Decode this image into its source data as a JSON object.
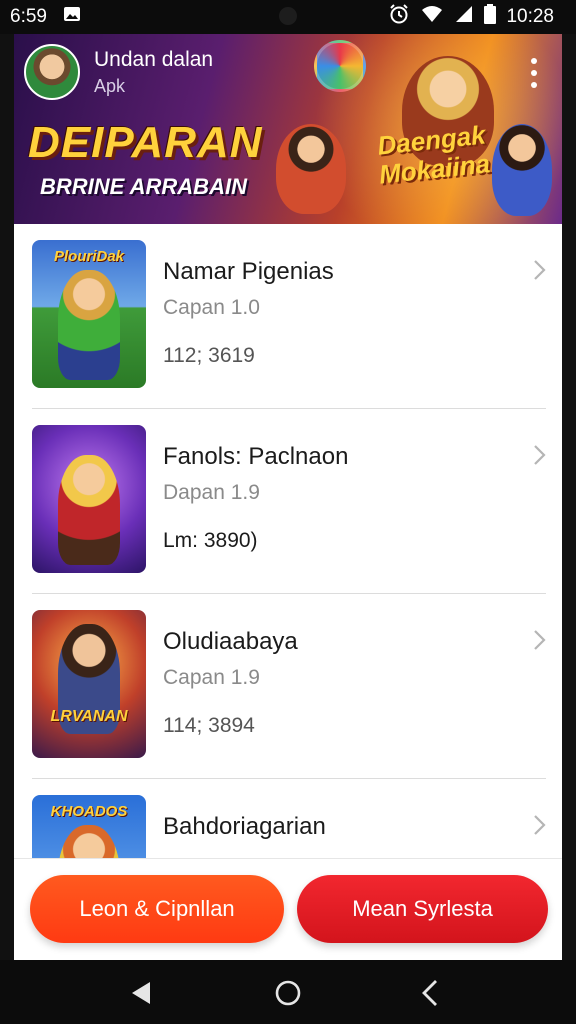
{
  "status_bar": {
    "time": "6:59",
    "clock": "10:28",
    "icons": [
      "image-icon",
      "alarm-icon",
      "wifi-icon",
      "signal-icon",
      "battery-icon"
    ]
  },
  "header": {
    "app_name": "Undan dalan",
    "app_subtitle": "Apk",
    "banner_headline": "DEIPARAN",
    "banner_tagline": "BRRINE ARRABAIN",
    "banner_promo": "Daengak Mokaiina"
  },
  "list": {
    "items": [
      {
        "title": "Namar Pigenias",
        "version": "Capan 1.0",
        "size": "112; 3619",
        "thumb_label": "PlouriDak"
      },
      {
        "title": "Fanols: Paclnaon",
        "version": "Dapan 1.9",
        "size": "Lm: 3890)",
        "thumb_label": ""
      },
      {
        "title": "Oludiaabaya",
        "version": "Capan 1.9",
        "size": "114; 3894",
        "thumb_label": "LRVANAN"
      },
      {
        "title": "Bahdoriagarian",
        "version": "",
        "size": "",
        "thumb_label": "KHOADOS"
      }
    ]
  },
  "actions": {
    "primary_label": "Leon & Cipnllan",
    "secondary_label": "Mean Syrlesta"
  },
  "colors": {
    "primary_button": "#ff4a18",
    "secondary_button": "#e21c24",
    "banner_gold": "#ffd23c"
  }
}
